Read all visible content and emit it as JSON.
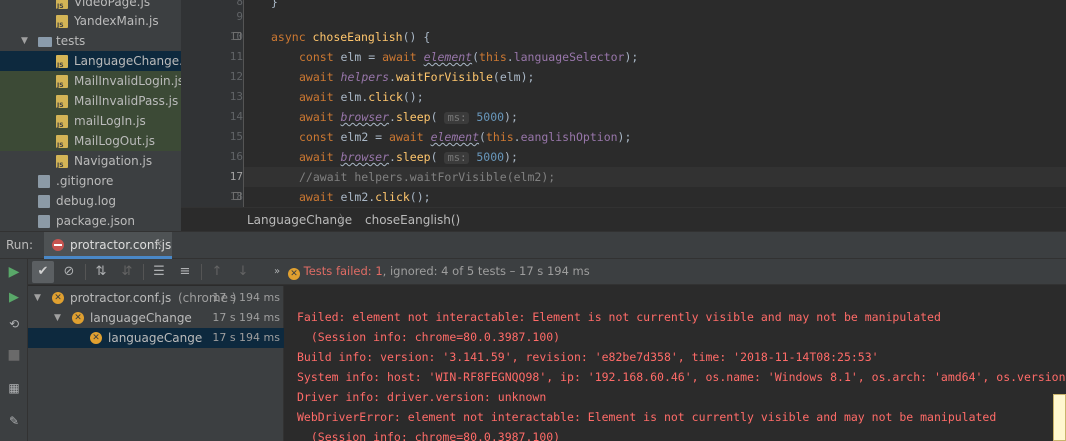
{
  "project_tree": {
    "items": [
      {
        "label": "VideoPage.js",
        "type": "js"
      },
      {
        "label": "YandexMain.js",
        "type": "js"
      },
      {
        "label": "tests",
        "type": "folder"
      },
      {
        "label": "LanguageChange.js",
        "type": "js"
      },
      {
        "label": "MailInvalidLogin.js",
        "type": "js"
      },
      {
        "label": "MailInvalidPass.js",
        "type": "js"
      },
      {
        "label": "mailLogIn.js",
        "type": "js"
      },
      {
        "label": "MailLogOut.js",
        "type": "js"
      },
      {
        "label": "Navigation.js",
        "type": "js"
      },
      {
        "label": ".gitignore",
        "type": "file"
      },
      {
        "label": "debug.log",
        "type": "file"
      },
      {
        "label": "package.json",
        "type": "file"
      }
    ]
  },
  "editor": {
    "line_numbers": [
      "8",
      "9",
      "10",
      "11",
      "12",
      "13",
      "14",
      "15",
      "16",
      "17",
      "18"
    ],
    "l8": "}",
    "l10_kw": "async ",
    "l10_fn": "choseEanglish",
    "l10_rest": "() {",
    "l11_a": "const ",
    "l11_b": "elm = ",
    "l11_c": "await ",
    "l11_d": "element",
    "l11_e": "(",
    "l11_f": "this",
    "l11_g": ".",
    "l11_h": "languageSelector",
    "l11_i": ");",
    "l12_a": "await ",
    "l12_b": "helpers",
    "l12_c": ".",
    "l12_d": "waitForVisible",
    "l12_e": "(elm);",
    "l13_a": "await ",
    "l13_b": "elm.",
    "l13_c": "click",
    "l13_d": "();",
    "l14_a": "await ",
    "l14_b": "browser",
    "l14_c": ".",
    "l14_d": "sleep",
    "l14_e": "( ",
    "l14_hint": "ms:",
    "l14_num": "5000",
    "l14_end": ");",
    "l15_a": "const ",
    "l15_b": "elm2 = ",
    "l15_c": "await ",
    "l15_d": "element",
    "l15_e": "(",
    "l15_f": "this",
    "l15_g": ".",
    "l15_h": "eanglishOption",
    "l15_i": ");",
    "l16_a": "await ",
    "l16_b": "browser",
    "l16_c": ".",
    "l16_d": "sleep",
    "l16_e": "( ",
    "l16_hint": "ms:",
    "l16_num": "5000",
    "l16_end": ");",
    "l17": "//await helpers.waitForVisible(elm2);",
    "l18_a": "await ",
    "l18_b": "elm2.",
    "l18_c": "click",
    "l18_d": "();"
  },
  "breadcrumb": {
    "file": "LanguageChange",
    "separator": "〉",
    "method": "choseEanglish()"
  },
  "run_bar": {
    "label": "Run:",
    "tab": "protractor.conf.js",
    "close": "×"
  },
  "toolbar": {
    "status_label": "Tests failed: ",
    "failed_count": "1",
    "rest": ", ignored: 4 of 5 tests – 17 s 194 ms"
  },
  "test_tree": [
    {
      "label": "protractor.conf.js",
      "suffix": " (chrome )",
      "time": "17 s 194 ms"
    },
    {
      "label": "languageChange",
      "suffix": "",
      "time": "17 s 194 ms"
    },
    {
      "label": "languageCange",
      "suffix": "",
      "time": "17 s 194 ms"
    }
  ],
  "console": {
    "lines": [
      "Failed: element not interactable: Element is not currently visible and may not be manipulated",
      "  (Session info: chrome=80.0.3987.100)",
      "Build info: version: '3.141.59', revision: 'e82be7d358', time: '2018-11-14T08:25:53'",
      "System info: host: 'WIN-RF8FEGNQQ98', ip: '192.168.60.46', os.name: 'Windows 8.1', os.arch: 'amd64', os.version",
      "Driver info: driver.version: unknown",
      "WebDriverError: element not interactable: Element is not currently visible and may not be manipulated",
      "  (Session info: chrome=80.0.3987.100)"
    ]
  },
  "colors": {
    "error": "#ff6b68",
    "warning_icon": "#e0a030",
    "selection": "#0d293e",
    "accent": "#4a88c7"
  }
}
